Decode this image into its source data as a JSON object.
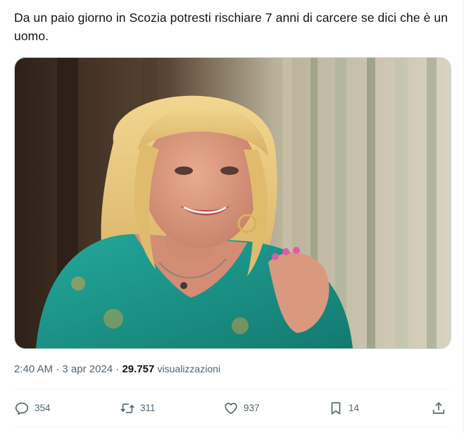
{
  "tweet": {
    "text": "Da un paio giorno in Scozia potresti rischiare 7 anni di carcere se dici che è un uomo.",
    "media": {
      "icon": "photo-portrait",
      "colors": {
        "background_dark": "#3a2a1e",
        "background_light": "#d9d4c4",
        "hair": "#e9c679",
        "skin": "#d99b82",
        "dress": "#1f9a8f",
        "nails": "#e25aa6"
      }
    },
    "time": "2:40 AM",
    "separator": "·",
    "date": "3 apr 2024",
    "views_count": "29.757",
    "views_label": "visualizzazioni"
  },
  "actions": {
    "reply": {
      "icon": "reply-bubble-icon",
      "count": "354"
    },
    "retweet": {
      "icon": "retweet-icon",
      "count": "311"
    },
    "like": {
      "icon": "heart-icon",
      "count": "937"
    },
    "bookmark": {
      "icon": "bookmark-icon",
      "count": "14"
    },
    "share": {
      "icon": "share-icon"
    }
  },
  "colors": {
    "text_primary": "#0f1419",
    "text_secondary": "#536471",
    "border": "#cfd9de",
    "divider": "#eff3f4"
  }
}
